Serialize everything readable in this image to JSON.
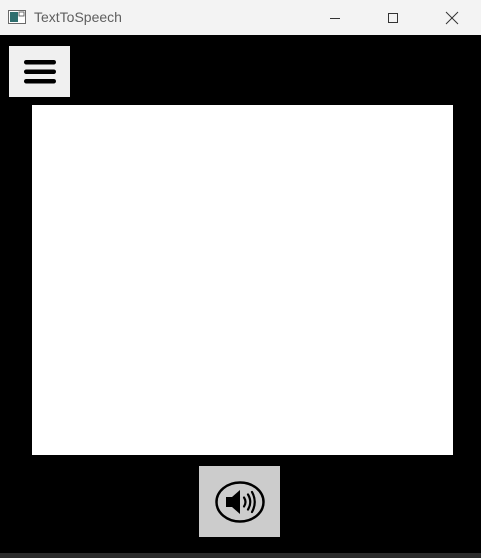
{
  "window": {
    "title": "TextToSpeech",
    "controls": {
      "minimize_icon": "minimize-icon",
      "maximize_icon": "maximize-icon",
      "close_icon": "close-icon"
    }
  },
  "toolbar": {
    "menu_icon": "hamburger-menu-icon"
  },
  "editor": {
    "value": "",
    "placeholder": ""
  },
  "actions": {
    "speak_icon": "speaker-volume-icon"
  },
  "colors": {
    "background": "#000000",
    "titlebar": "#f3f3f3",
    "menu_button": "#f0f0f0",
    "editor_background": "#ffffff",
    "speak_button": "#cccccc"
  }
}
